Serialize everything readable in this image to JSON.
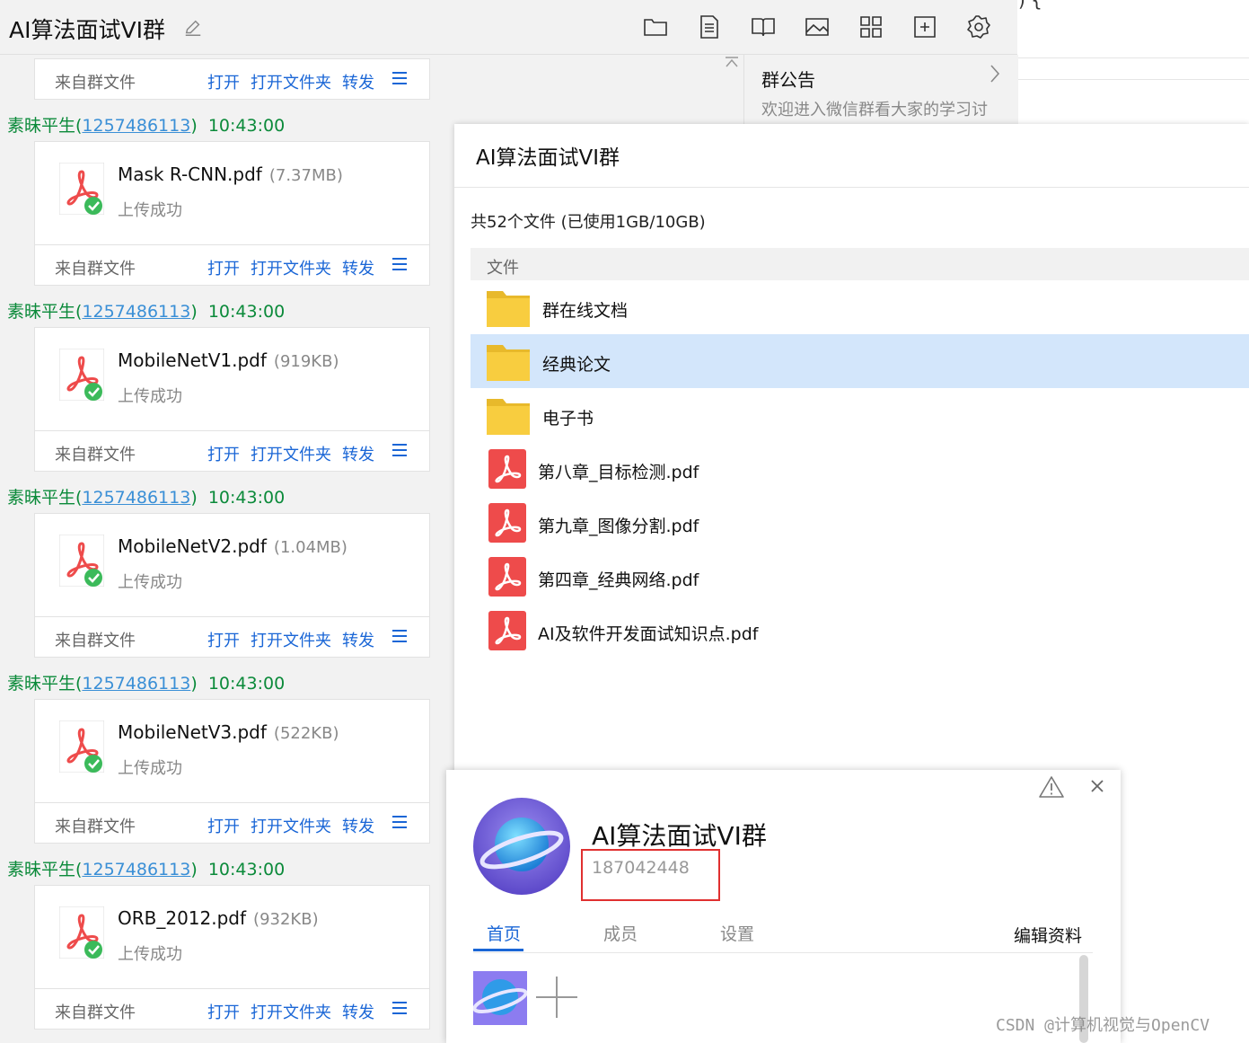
{
  "header": {
    "title": "AI算法面试VI群",
    "tools": [
      "folder-icon",
      "document-icon",
      "book-icon",
      "image-icon",
      "apps-icon",
      "add-box-icon",
      "gear-icon"
    ]
  },
  "background_code": ") {",
  "chat": {
    "footer": {
      "source": "来自群文件",
      "open": "打开",
      "open_folder": "打开文件夹",
      "forward": "转发"
    },
    "messages": [
      {
        "sender": "素昧平生(",
        "qq": "1257486113",
        "close": ")",
        "time": "10:43:00",
        "file": "Mask R-CNN.pdf",
        "size": "(7.37MB)",
        "status": "上传成功"
      },
      {
        "sender": "素昧平生(",
        "qq": "1257486113",
        "close": ")",
        "time": "10:43:00",
        "file": "MobileNetV1.pdf",
        "size": "(919KB)",
        "status": "上传成功"
      },
      {
        "sender": "素昧平生(",
        "qq": "1257486113",
        "close": ")",
        "time": "10:43:00",
        "file": "MobileNetV2.pdf",
        "size": "(1.04MB)",
        "status": "上传成功"
      },
      {
        "sender": "素昧平生(",
        "qq": "1257486113",
        "close": ")",
        "time": "10:43:00",
        "file": "MobileNetV3.pdf",
        "size": "(522KB)",
        "status": "上传成功"
      },
      {
        "sender": "素昧平生(",
        "qq": "1257486113",
        "close": ")",
        "time": "10:43:00",
        "file": "ORB_2012.pdf",
        "size": "(932KB)",
        "status": "上传成功"
      }
    ]
  },
  "announcement": {
    "title": "群公告",
    "text": "欢迎进入微信群看大家的学习讨"
  },
  "files_panel": {
    "title": "AI算法面试VI群",
    "count": "共52个文件 (已使用1GB/10GB)",
    "column": "文件",
    "rows": [
      {
        "type": "folder",
        "name": "群在线文档"
      },
      {
        "type": "folder",
        "name": "经典论文"
      },
      {
        "type": "folder",
        "name": "电子书"
      },
      {
        "type": "pdf",
        "name": "第八章_目标检测.pdf"
      },
      {
        "type": "pdf",
        "name": "第九章_图像分割.pdf"
      },
      {
        "type": "pdf",
        "name": "第四章_经典网络.pdf"
      },
      {
        "type": "pdf",
        "name": "AI及软件开发面试知识点.pdf"
      }
    ]
  },
  "profile": {
    "name": "AI算法面试VI群",
    "group_id": "187042448",
    "tabs": [
      "首页",
      "成员",
      "设置"
    ],
    "edit": "编辑资料"
  },
  "watermark": "CSDN @计算机视觉与OpenCV",
  "colors": {
    "accent": "#1a66d6",
    "sender": "#0b8a3a",
    "selected_row": "#d3e6fb",
    "pdf_red": "#ee4b4b",
    "folder": "#f8cd3f",
    "highlight_box": "#e03030"
  }
}
